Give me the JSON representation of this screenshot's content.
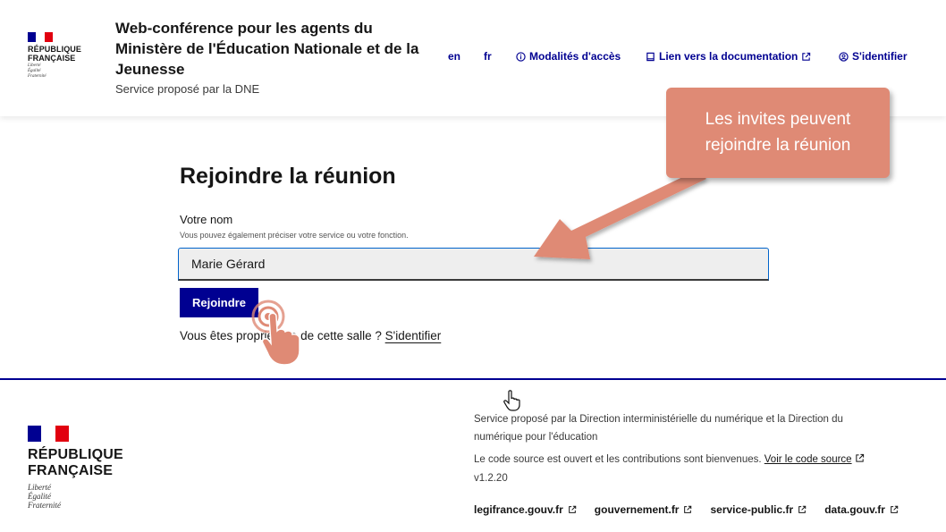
{
  "header": {
    "logo_line1": "RÉPUBLIQUE",
    "logo_line2": "FRANÇAISE",
    "devise": [
      "Liberté",
      "Égalité",
      "Fraternité"
    ],
    "service_title": "Web-conférence pour les agents du Ministère de l'Éducation Nationale et de la Jeunesse",
    "service_tagline": "Service proposé par la DNE",
    "nav": {
      "lang_en": "en",
      "lang_fr": "fr",
      "access": "Modalités d'accès",
      "docs": "Lien vers la documentation",
      "login": "S'identifier"
    }
  },
  "main": {
    "title": "Rejoindre la réunion",
    "name_label": "Votre nom",
    "name_hint": "Vous pouvez également préciser votre service ou votre fonction.",
    "name_value": "Marie Gérard",
    "join_button": "Rejoindre",
    "owner_text": "Vous êtes propriétaire de cette salle ?",
    "owner_link": "S'identifier"
  },
  "footer": {
    "logo_line1": "RÉPUBLIQUE",
    "logo_line2": "FRANÇAISE",
    "devise": [
      "Liberté",
      "Égalité",
      "Fraternité"
    ],
    "description": "Service proposé par la Direction interministérielle du numérique et la Direction du numérique pour l'éducation",
    "source_text": "Le code source est ouvert et les contributions sont bienvenues.",
    "source_link": "Voir le code source",
    "version": "v1.2.20",
    "links": [
      "legifrance.gouv.fr",
      "gouvernement.fr",
      "service-public.fr",
      "data.gouv.fr"
    ]
  },
  "overlay": {
    "callout_line1": "Les invites peuvent",
    "callout_line2": "rejoindre la réunion"
  },
  "colors": {
    "primary": "#000091",
    "flag_blue": "#000091",
    "flag_white": "#ffffff",
    "flag_red": "#e1000f",
    "callout": "#df8a75",
    "input_focus": "#0063cb"
  }
}
